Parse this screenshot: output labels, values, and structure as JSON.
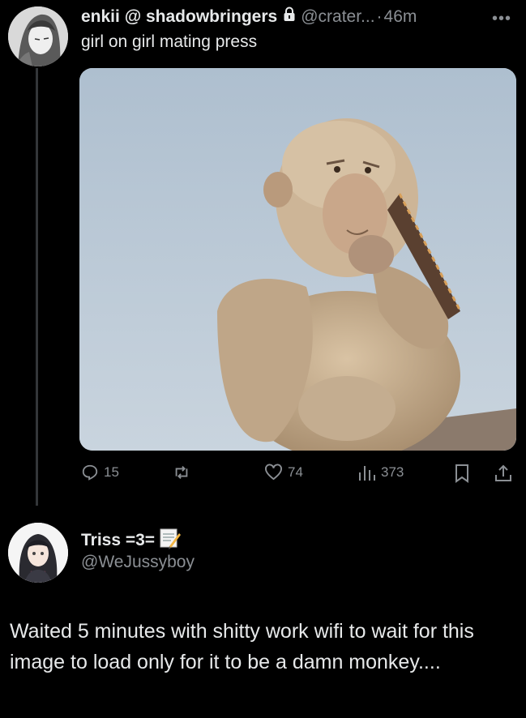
{
  "tweet": {
    "display_name": "enkii @ shadowbringers",
    "lock_icon": "lock-icon",
    "handle": "@crater...",
    "separator": "·",
    "time": "46m",
    "more_icon": "more-dots-icon",
    "text": "girl on girl mating press",
    "media_icon": "photo-monkey-with-glasses",
    "actions": {
      "reply_count": "15",
      "repost_count": "",
      "like_count": "74",
      "views_count": "373"
    }
  },
  "reply": {
    "display_name": "Triss =3=",
    "name_emoji": "memo-icon",
    "handle": "@WeJussyboy",
    "text": "Waited 5 minutes with shitty work wifi to wait for this image to load only for it to be a damn monkey...."
  },
  "colors": {
    "background": "#000000",
    "text_primary": "#e7e9ea",
    "text_secondary": "#8b8f94",
    "thread_line": "#333639"
  }
}
